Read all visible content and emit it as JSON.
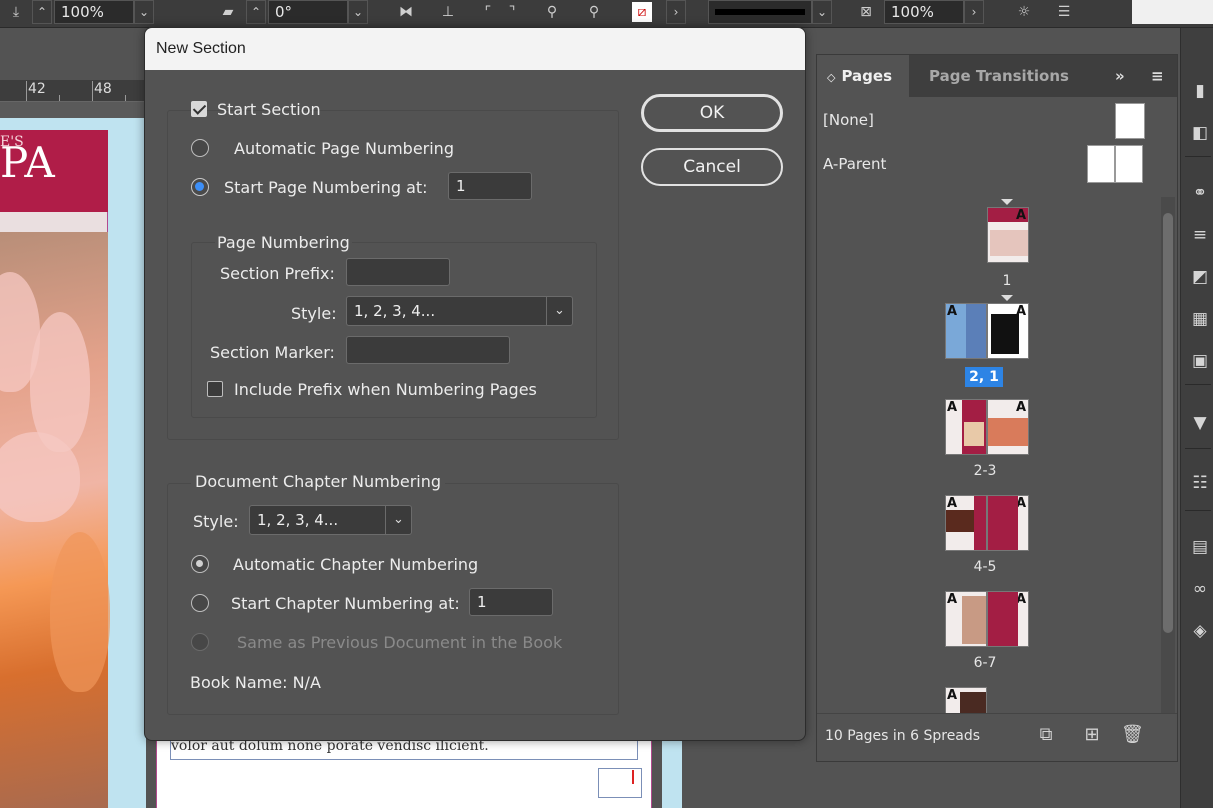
{
  "toolbar": {
    "scale_x": "100%",
    "rotation": "0°",
    "opacity": "100%"
  },
  "ruler": {
    "marks": [
      "42",
      "48"
    ]
  },
  "document": {
    "spa_small": "E'S",
    "spa_letters": "PA",
    "body_line": "volor aut dolum none porate vendisc ilicient."
  },
  "dialog": {
    "title": "New Section",
    "start_section": "Start Section",
    "automatic_page_numbering": "Automatic Page Numbering",
    "start_page_numbering_at": "Start Page Numbering at:",
    "start_page_value": "1",
    "page_numbering_group": "Page Numbering",
    "section_prefix_label": "Section Prefix:",
    "section_prefix_value": "",
    "style_label": "Style:",
    "style_value": "1, 2, 3, 4...",
    "section_marker_label": "Section Marker:",
    "section_marker_value": "",
    "include_prefix": "Include Prefix when Numbering Pages",
    "chapter_group": "Document Chapter Numbering",
    "chapter_style_label": "Style:",
    "chapter_style_value": "1, 2, 3, 4...",
    "automatic_chapter_numbering": "Automatic Chapter Numbering",
    "start_chapter_numbering_at": "Start Chapter Numbering at:",
    "start_chapter_value": "1",
    "same_as_previous": "Same as Previous Document in the Book",
    "book_name": "Book Name: N/A",
    "ok": "OK",
    "cancel": "Cancel"
  },
  "pages_panel": {
    "tab_pages": "Pages",
    "tab_transitions": "Page Transitions",
    "parents": [
      "[None]",
      "A-Parent"
    ],
    "spreads": [
      "1",
      "2, 1",
      "2-3",
      "4-5",
      "6-7"
    ],
    "footer": "10 Pages in 6 Spreads"
  },
  "colors": {
    "accent_blue": "#2d84e5",
    "brand_red": "#a31e44",
    "dialog_bg": "#535353"
  },
  "icons": [
    "chevron-down-icon",
    "flip-icon",
    "align-icon",
    "fill-stroke-icon",
    "expand-icon",
    "menu-icon",
    "new-page-icon",
    "delete-icon",
    "pages-icon",
    "layers-icon",
    "links-icon"
  ]
}
